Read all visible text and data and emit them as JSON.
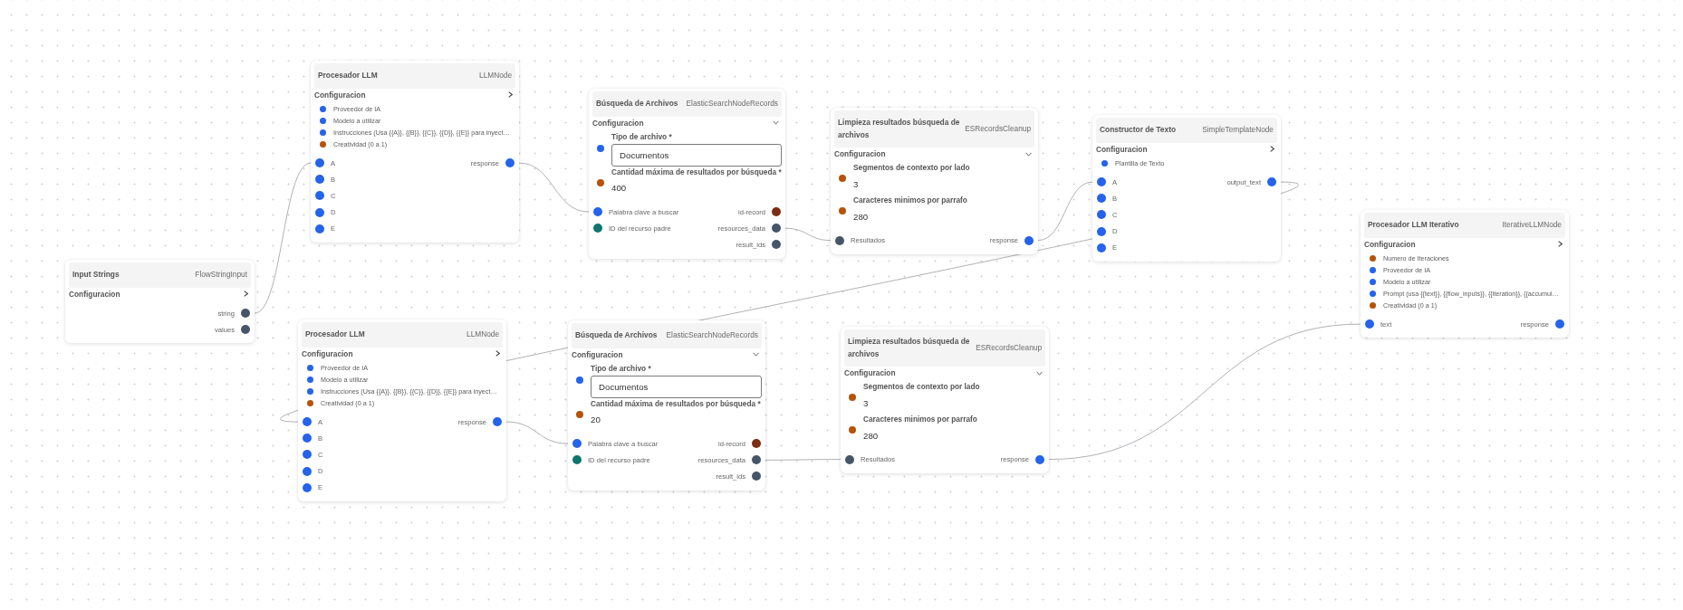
{
  "nodes": [
    {
      "title": "Input Strings",
      "type": "FlowStringInput",
      "config": {
        "label": "Configuracion",
        "expanded": false
      },
      "ports": [
        {
          "output": {
            "label": "string",
            "color": "#475569"
          }
        },
        {
          "output": {
            "label": "values",
            "color": "#475569"
          }
        }
      ]
    },
    {
      "title": "Procesador LLM",
      "type": "LLMNode",
      "config": {
        "label": "Configuracion",
        "expanded": false,
        "params": [
          {
            "label": "Proveedor de IA",
            "color": "#2563eb"
          },
          {
            "label": "Modelo a utilizar",
            "color": "#2563eb"
          },
          {
            "label": "Instrucciones (Usa {{A}}, {{B}}, {{C}}, {{D}}, {{E}} para inyect…",
            "color": "#2563eb"
          },
          {
            "label": "Creatividad (0 a 1)",
            "color": "#b45309"
          }
        ]
      },
      "ports": [
        {
          "input": {
            "label": "A",
            "color": "#2563eb"
          },
          "output": {
            "label": "response",
            "color": "#2563eb"
          }
        },
        {
          "input": {
            "label": "B",
            "color": "#2563eb"
          }
        },
        {
          "input": {
            "label": "C",
            "color": "#2563eb"
          }
        },
        {
          "input": {
            "label": "D",
            "color": "#2563eb"
          }
        },
        {
          "input": {
            "label": "E",
            "color": "#2563eb"
          }
        }
      ]
    },
    {
      "title": "Búsqueda de Archivos",
      "type": "ElasticSearchNodeRecords",
      "config": {
        "label": "Configuracion",
        "expanded": true,
        "fields": [
          {
            "kind": "input",
            "label": "Tipo de archivo *",
            "value": "Documentos",
            "color": "#2563eb"
          },
          {
            "kind": "number",
            "label": "Cantidad máxima de resultados por búsqueda *",
            "value": "400",
            "color": "#b45309"
          }
        ]
      },
      "ports": [
        {
          "input": {
            "label": "Palabra clave a buscar",
            "color": "#2563eb"
          },
          "output": {
            "label": "id-record",
            "color": "#7c2d12"
          }
        },
        {
          "input": {
            "label": "ID del recurso padre",
            "color": "#0f766e"
          },
          "output": {
            "label": "resources_data",
            "color": "#475569"
          }
        },
        {
          "output": {
            "label": "result_ids",
            "color": "#475569"
          }
        }
      ]
    },
    {
      "title": "Limpieza resultados búsqueda de archivos",
      "type": "ESRecordsCleanup",
      "config": {
        "label": "Configuracion",
        "expanded": true,
        "fields": [
          {
            "kind": "number",
            "label": "Segmentos de contexto por lado",
            "value": "3",
            "color": "#b45309"
          },
          {
            "kind": "number",
            "label": "Caracteres minimos por parrafo",
            "value": "280",
            "color": "#b45309"
          }
        ]
      },
      "ports": [
        {
          "input": {
            "label": "Resultados",
            "color": "#475569"
          },
          "output": {
            "label": "response",
            "color": "#2563eb"
          }
        }
      ]
    },
    {
      "title": "Constructor de Texto",
      "type": "SimpleTemplateNode",
      "config": {
        "label": "Configuracion",
        "expanded": false,
        "params": [
          {
            "label": "Plantilla de Texto",
            "color": "#2563eb"
          }
        ]
      },
      "ports": [
        {
          "input": {
            "label": "A",
            "color": "#2563eb"
          },
          "output": {
            "label": "output_text",
            "color": "#2563eb"
          }
        },
        {
          "input": {
            "label": "B",
            "color": "#2563eb"
          }
        },
        {
          "input": {
            "label": "C",
            "color": "#2563eb"
          }
        },
        {
          "input": {
            "label": "D",
            "color": "#2563eb"
          }
        },
        {
          "input": {
            "label": "E",
            "color": "#2563eb"
          }
        }
      ]
    },
    {
      "title": "Procesador LLM Iterativo",
      "type": "IterativeLLMNode",
      "config": {
        "label": "Configuracion",
        "expanded": false,
        "params": [
          {
            "label": "Numero de Iteraciones",
            "color": "#b45309"
          },
          {
            "label": "Proveedor de IA",
            "color": "#2563eb"
          },
          {
            "label": "Modelo a utilizar",
            "color": "#2563eb"
          },
          {
            "label": "Prompt (usa {{text}}, {{flow_inputs}}, {{iteration}}, {{accumul…",
            "color": "#2563eb"
          },
          {
            "label": "Creatividad (0 a 1)",
            "color": "#b45309"
          }
        ]
      },
      "ports": [
        {
          "input": {
            "label": "text",
            "color": "#2563eb"
          },
          "output": {
            "label": "response",
            "color": "#2563eb"
          }
        }
      ]
    },
    {
      "title": "Procesador LLM",
      "type": "LLMNode",
      "config": {
        "label": "Configuracion",
        "expanded": false,
        "params": [
          {
            "label": "Proveedor de IA",
            "color": "#2563eb"
          },
          {
            "label": "Modelo a utilizar",
            "color": "#2563eb"
          },
          {
            "label": "Instrucciones (Usa {{A}}, {{B}}, {{C}}, {{D}}, {{E}} para inyect…",
            "color": "#2563eb"
          },
          {
            "label": "Creatividad (0 a 1)",
            "color": "#b45309"
          }
        ]
      },
      "ports": [
        {
          "input": {
            "label": "A",
            "color": "#2563eb"
          },
          "output": {
            "label": "response",
            "color": "#2563eb"
          }
        },
        {
          "input": {
            "label": "B",
            "color": "#2563eb"
          }
        },
        {
          "input": {
            "label": "C",
            "color": "#2563eb"
          }
        },
        {
          "input": {
            "label": "D",
            "color": "#2563eb"
          }
        },
        {
          "input": {
            "label": "E",
            "color": "#2563eb"
          }
        }
      ]
    },
    {
      "title": "Búsqueda de Archivos",
      "type": "ElasticSearchNodeRecords",
      "config": {
        "label": "Configuracion",
        "expanded": true,
        "fields": [
          {
            "kind": "input",
            "label": "Tipo de archivo *",
            "value": "Documentos",
            "color": "#2563eb"
          },
          {
            "kind": "number",
            "label": "Cantidad máxima de resultados por búsqueda *",
            "value": "20",
            "color": "#b45309"
          }
        ]
      },
      "ports": [
        {
          "input": {
            "label": "Palabra clave a buscar",
            "color": "#2563eb"
          },
          "output": {
            "label": "id-record",
            "color": "#7c2d12"
          }
        },
        {
          "input": {
            "label": "ID del recurso padre",
            "color": "#0f766e"
          },
          "output": {
            "label": "resources_data",
            "color": "#475569"
          }
        },
        {
          "output": {
            "label": "result_ids",
            "color": "#475569"
          }
        }
      ]
    },
    {
      "title": "Limpieza resultados búsqueda de archivos",
      "type": "ESRecordsCleanup",
      "config": {
        "label": "Configuracion",
        "expanded": true,
        "fields": [
          {
            "kind": "number",
            "label": "Segmentos de contexto por lado",
            "value": "3",
            "color": "#b45309"
          },
          {
            "kind": "number",
            "label": "Caracteres minimos por parrafo",
            "value": "280",
            "color": "#b45309"
          }
        ]
      },
      "ports": [
        {
          "input": {
            "label": "Resultados",
            "color": "#475569"
          },
          "output": {
            "label": "response",
            "color": "#2563eb"
          }
        }
      ]
    }
  ]
}
